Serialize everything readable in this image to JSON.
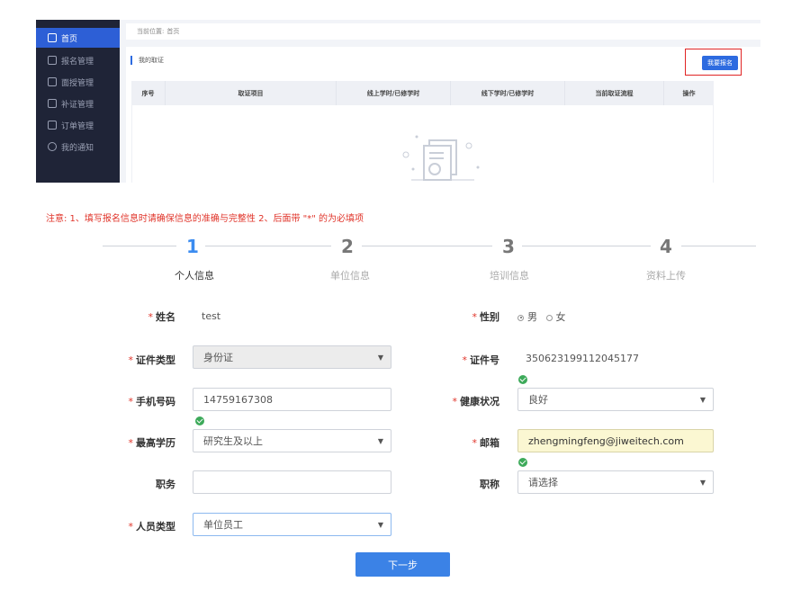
{
  "sidebar": {
    "items": [
      {
        "label": "首页",
        "icon": "home-icon",
        "active": true
      },
      {
        "label": "报名管理",
        "icon": "signup-icon"
      },
      {
        "label": "面授管理",
        "icon": "classroom-icon"
      },
      {
        "label": "补证管理",
        "icon": "certificate-icon"
      },
      {
        "label": "订单管理",
        "icon": "order-icon"
      },
      {
        "label": "我的通知",
        "icon": "message-icon"
      }
    ]
  },
  "breadcrumb": {
    "prefix": "当前位置:",
    "current": "首页"
  },
  "panel": {
    "title": "我的取证",
    "apply_label": "我要报名",
    "columns": [
      "序号",
      "取证项目",
      "线上学时/已修学时",
      "线下学时/已修学时",
      "当前取证流程",
      "操作"
    ]
  },
  "note": "注意: 1、填写报名信息时请确保信息的准确与完整性 2、后面带 \"*\" 的为必填项",
  "steps": [
    {
      "num": "1",
      "label": "个人信息",
      "active": true
    },
    {
      "num": "2",
      "label": "单位信息"
    },
    {
      "num": "3",
      "label": "培训信息"
    },
    {
      "num": "4",
      "label": "资料上传"
    }
  ],
  "form": {
    "name": {
      "label": "姓名",
      "value": "test"
    },
    "gender": {
      "label": "性别",
      "male": "男",
      "female": "女",
      "selected": "男"
    },
    "id_type": {
      "label": "证件类型",
      "value": "身份证"
    },
    "id_number": {
      "label": "证件号",
      "value": "350623199112045177"
    },
    "phone": {
      "label": "手机号码",
      "value": "14759167308"
    },
    "health": {
      "label": "健康状况",
      "value": "良好"
    },
    "education": {
      "label": "最高学历",
      "value": "研究生及以上"
    },
    "email": {
      "label": "邮箱",
      "value": "zhengmingfeng@jiweitech.com"
    },
    "position": {
      "label": "职务",
      "value": ""
    },
    "title": {
      "label": "职称",
      "value": "请选择"
    },
    "staff_type": {
      "label": "人员类型",
      "value": "单位员工"
    }
  },
  "next_label": "下一步",
  "colors": {
    "primary": "#3b82e6",
    "required": "#e0342a",
    "success": "#3daa5a",
    "sidebar": "#1f2437"
  }
}
